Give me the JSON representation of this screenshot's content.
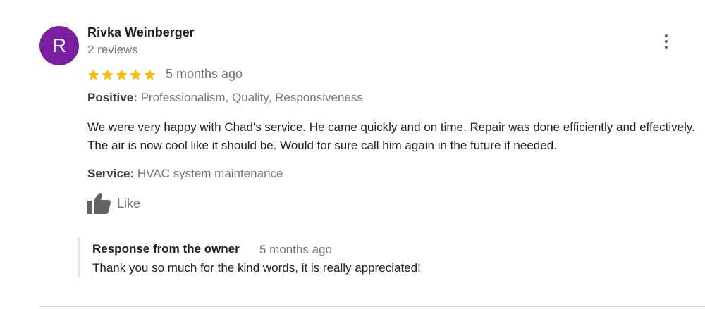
{
  "review": {
    "avatar_initial": "R",
    "avatar_color": "#7b1fa2",
    "reviewer_name": "Rivka Weinberger",
    "review_count": "2 reviews",
    "rating": 5,
    "rating_max": 5,
    "star_color": "#fbbc04",
    "date": "5 months ago",
    "positive_label": "Positive:",
    "positive_value": "Professionalism, Quality, Responsiveness",
    "text": "We were very happy with Chad's service. He came quickly and on time. Repair was done efficiently and effectively. The air is now cool like it should be. Would for sure call him again in the future if needed.",
    "service_label": "Service:",
    "service_value": "HVAC system maintenance",
    "like_label": "Like",
    "more_icon": "more-vert-icon"
  },
  "owner_response": {
    "title": "Response from the owner",
    "date": "5 months ago",
    "text": "Thank you so much for the kind words, it is really appreciated!"
  }
}
